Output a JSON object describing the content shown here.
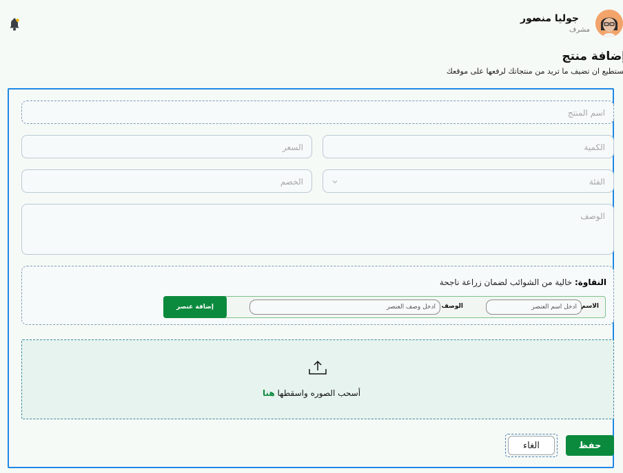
{
  "header": {
    "user_name": "جوليا منصور",
    "user_role": "مشرف"
  },
  "page": {
    "title": "إضافة منتج",
    "subtitle": "تستطيع ان تضيف ما تريد من منتجاتك لرفعها على موقعك"
  },
  "form": {
    "name_placeholder": "اسم المنتج",
    "quantity_placeholder": "الكمية",
    "price_placeholder": "السعر",
    "category_placeholder": "الفئة",
    "discount_placeholder": "الخصم",
    "description_placeholder": "الوصف"
  },
  "features": {
    "purity_label": "النقاوة:",
    "purity_text": " خالية من الشوائب لضمان زراعة ناجحة",
    "name_label": "الاسم",
    "name_placeholder": "ادخل اسم العنصر",
    "desc_label": "الوصف",
    "desc_placeholder": "ادخل وصف العنصر",
    "add_button": "إضافة عنصر"
  },
  "upload": {
    "text": "أسحب الصوره واسقطها ",
    "link": "هنا"
  },
  "actions": {
    "save": "حفظ",
    "cancel": "الغاء"
  },
  "colors": {
    "accent_green": "#0b8a3d",
    "card_border_blue": "#1e88e5"
  }
}
